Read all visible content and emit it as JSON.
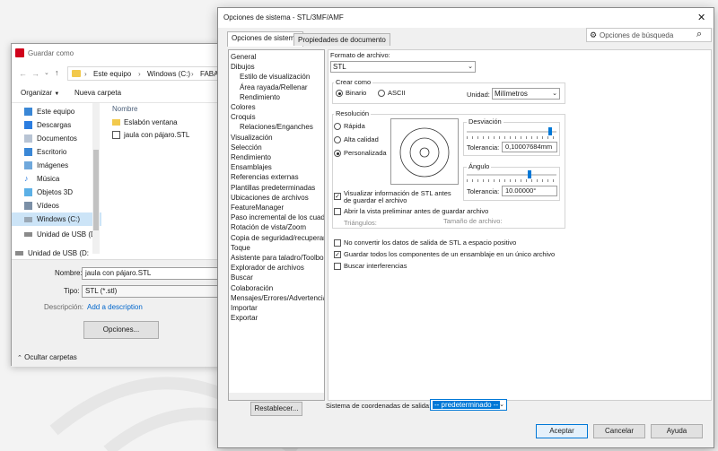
{
  "save_dialog": {
    "title": "Guardar como",
    "path": [
      "Este equipo",
      "Windows (C:)",
      "FABAC"
    ],
    "organize_label": "Organizar",
    "new_folder_label": "Nueva carpeta",
    "tree": [
      {
        "label": "Este equipo",
        "icon": "computer-icon"
      },
      {
        "label": "Descargas",
        "icon": "download-icon"
      },
      {
        "label": "Documentos",
        "icon": "document-icon"
      },
      {
        "label": "Escritorio",
        "icon": "desktop-icon"
      },
      {
        "label": "Imágenes",
        "icon": "image-icon"
      },
      {
        "label": "Música",
        "icon": "music-icon"
      },
      {
        "label": "Objetos 3D",
        "icon": "cube-icon"
      },
      {
        "label": "Vídeos",
        "icon": "video-icon"
      },
      {
        "label": "Windows (C:)",
        "icon": "drive-icon"
      },
      {
        "label": "Unidad de USB (D",
        "icon": "usb-icon"
      },
      {
        "label": "Unidad de USB (D:",
        "icon": "usb-icon"
      }
    ],
    "files_header": "Nombre",
    "files": [
      {
        "name": "Eslabón ventana",
        "icon": "folder-icon"
      },
      {
        "name": "jaula con pájaro.STL",
        "icon": "stl-file-icon"
      }
    ],
    "filename_label": "Nombre:",
    "filename_value": "jaula con pájaro.STL",
    "type_label": "Tipo:",
    "type_value": "STL (*.stl)",
    "description_label": "Descripción:",
    "description_link": "Add a description",
    "options_button": "Opciones...",
    "hide_folders": "Ocultar carpetas"
  },
  "options_dialog": {
    "title": "Opciones de sistema - STL/3MF/AMF",
    "tabs": [
      "Opciones de sistema",
      "Propiedades de documento"
    ],
    "search_placeholder": "Opciones de búsqueda",
    "nav": [
      {
        "label": "General",
        "indent": 0
      },
      {
        "label": "Dibujos",
        "indent": 0
      },
      {
        "label": "Estilo de visualización",
        "indent": 1
      },
      {
        "label": "Área rayada/Rellenar",
        "indent": 1
      },
      {
        "label": "Rendimiento",
        "indent": 1
      },
      {
        "label": "Colores",
        "indent": 0
      },
      {
        "label": "Croquis",
        "indent": 0
      },
      {
        "label": "Relaciones/Enganches",
        "indent": 1
      },
      {
        "label": "Visualización",
        "indent": 0
      },
      {
        "label": "Selección",
        "indent": 0
      },
      {
        "label": "Rendimiento",
        "indent": 0
      },
      {
        "label": "Ensamblajes",
        "indent": 0
      },
      {
        "label": "Referencias externas",
        "indent": 0
      },
      {
        "label": "Plantillas predeterminadas",
        "indent": 0
      },
      {
        "label": "Ubicaciones de archivos",
        "indent": 0
      },
      {
        "label": "FeatureManager",
        "indent": 0
      },
      {
        "label": "Paso incremental de los cuadr",
        "indent": 0
      },
      {
        "label": "Rotación de vista/Zoom",
        "indent": 0
      },
      {
        "label": "Copia de seguridad/recuperar",
        "indent": 0
      },
      {
        "label": "Toque",
        "indent": 0
      },
      {
        "label": "Asistente para taladro/Toolbox",
        "indent": 0
      },
      {
        "label": "Explorador de archivos",
        "indent": 0
      },
      {
        "label": "Buscar",
        "indent": 0
      },
      {
        "label": "Colaboración",
        "indent": 0
      },
      {
        "label": "Mensajes/Errores/Advertencias",
        "indent": 0
      },
      {
        "label": "Importar",
        "indent": 0
      },
      {
        "label": "Exportar",
        "indent": 0
      }
    ],
    "reset_button": "Restablecer...",
    "format_label": "Formato de archivo:",
    "format_value": "STL",
    "create_as_label": "Crear como",
    "binary_label": "Binario",
    "ascii_label": "ASCII",
    "unit_label": "Unidad:",
    "unit_value": "Milímetros",
    "resolution_label": "Resolución",
    "res_options": [
      "Rápida",
      "Alta calidad",
      "Personalizada"
    ],
    "deviation_label": "Desviación",
    "deviation_tol_label": "Tolerancia:",
    "deviation_value": "0,10007684mm",
    "deviation_slider_pct": 93,
    "angle_label": "Ángulo",
    "angle_tol_label": "Tolerancia:",
    "angle_value": "10.00000°",
    "angle_slider_pct": 70,
    "show_info_label": "Visualizar información de STL antes de guardar el archivo",
    "preview_label": "Abrir la vista preliminar antes de guardar archivo",
    "triangles_label": "Triángulos:",
    "filesize_label": "Tamaño de archivo:",
    "no_convert_label": "No convertir los datos de salida de STL a espacio positivo",
    "save_all_label": "Guardar todos los componentes de un ensamblaje en un único archivo",
    "check_interference_label": "Buscar interferencias",
    "coord_label": "Sistema de coordenadas de salida:",
    "coord_value": "-- predeterminado --",
    "accept_button": "Aceptar",
    "cancel_button": "Cancelar",
    "help_button": "Ayuda",
    "accent_color": "#0078d7"
  }
}
